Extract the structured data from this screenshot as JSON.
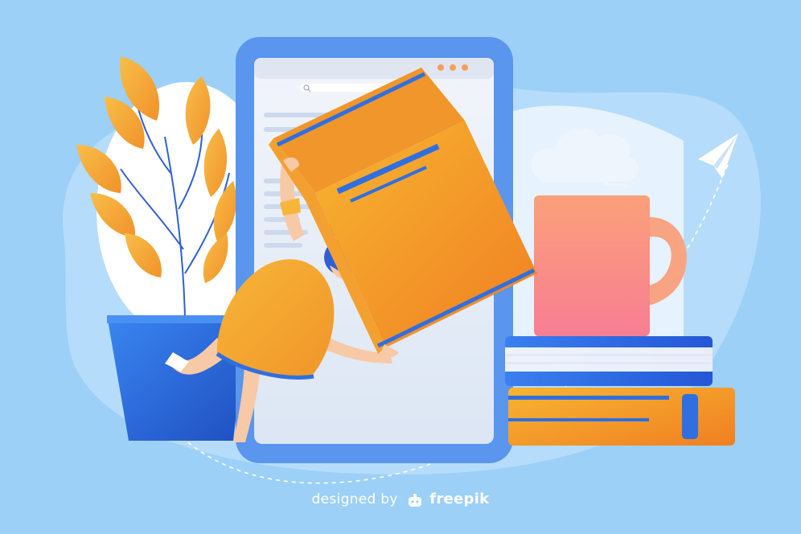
{
  "credit": {
    "prefix": "designed by",
    "brand": "freepik"
  },
  "colors": {
    "background": "#9cd0f7",
    "accent_blue": "#2f6fe0",
    "accent_orange": "#f4a030",
    "mug": "#f79a7e",
    "phone_frame": "#5a95ee",
    "screen": "#e8eef7"
  },
  "icons": [
    "freepik-logo-icon",
    "search-icon",
    "paper-plane-icon",
    "cloud-icon"
  ]
}
